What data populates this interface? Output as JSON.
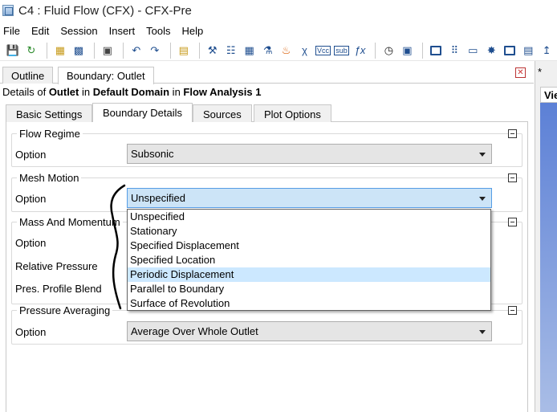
{
  "window": {
    "title": "C4 : Fluid Flow (CFX) - CFX-Pre"
  },
  "menu": [
    "File",
    "Edit",
    "Session",
    "Insert",
    "Tools",
    "Help"
  ],
  "toolbar_icons": [
    "save-icon",
    "refresh-icon",
    "import-mesh-icon",
    "mesh-icon",
    "camera-icon",
    "undo-icon",
    "redo-icon",
    "folder-icon",
    "domain-icon",
    "boundary-icon",
    "interface-icon",
    "material-icon",
    "source-icon",
    "expression-icon",
    "variable-icon",
    "subdomain-icon",
    "function-icon",
    "timer-icon",
    "monitor-icon",
    "region-icon",
    "axis-icon",
    "surface-icon",
    "points-icon",
    "solver-icon",
    "transient-icon",
    "plot-icon"
  ],
  "panel_tabs": [
    "Outline",
    "Boundary: Outlet"
  ],
  "details": {
    "prefix": "Details of ",
    "object": "Outlet",
    "mid1": " in ",
    "domain": "Default Domain",
    "mid2": " in ",
    "analysis": "Flow Analysis 1"
  },
  "inner_tabs": [
    "Basic Settings",
    "Boundary Details",
    "Sources",
    "Plot Options"
  ],
  "flow_regime": {
    "title": "Flow Regime",
    "option_label": "Option",
    "option_value": "Subsonic"
  },
  "mesh_motion": {
    "title": "Mesh Motion",
    "option_label": "Option",
    "option_value": "Unspecified"
  },
  "mass_momentum": {
    "title": "Mass And Momentum",
    "option_label": "Option",
    "rel_pressure_label": "Relative Pressure",
    "profile_blend_label": "Pres. Profile Blend"
  },
  "pressure_averaging": {
    "title": "Pressure Averaging",
    "option_label": "Option",
    "option_value": "Average Over Whole Outlet"
  },
  "dropdown": {
    "items": [
      "Unspecified",
      "Stationary",
      "Specified Displacement",
      "Specified Location",
      "Periodic Displacement",
      "Parallel to Boundary",
      "Surface of Revolution"
    ],
    "highlighted": "Periodic Displacement"
  },
  "right_panel": {
    "tab_symbol": "*",
    "header": "Vie"
  }
}
